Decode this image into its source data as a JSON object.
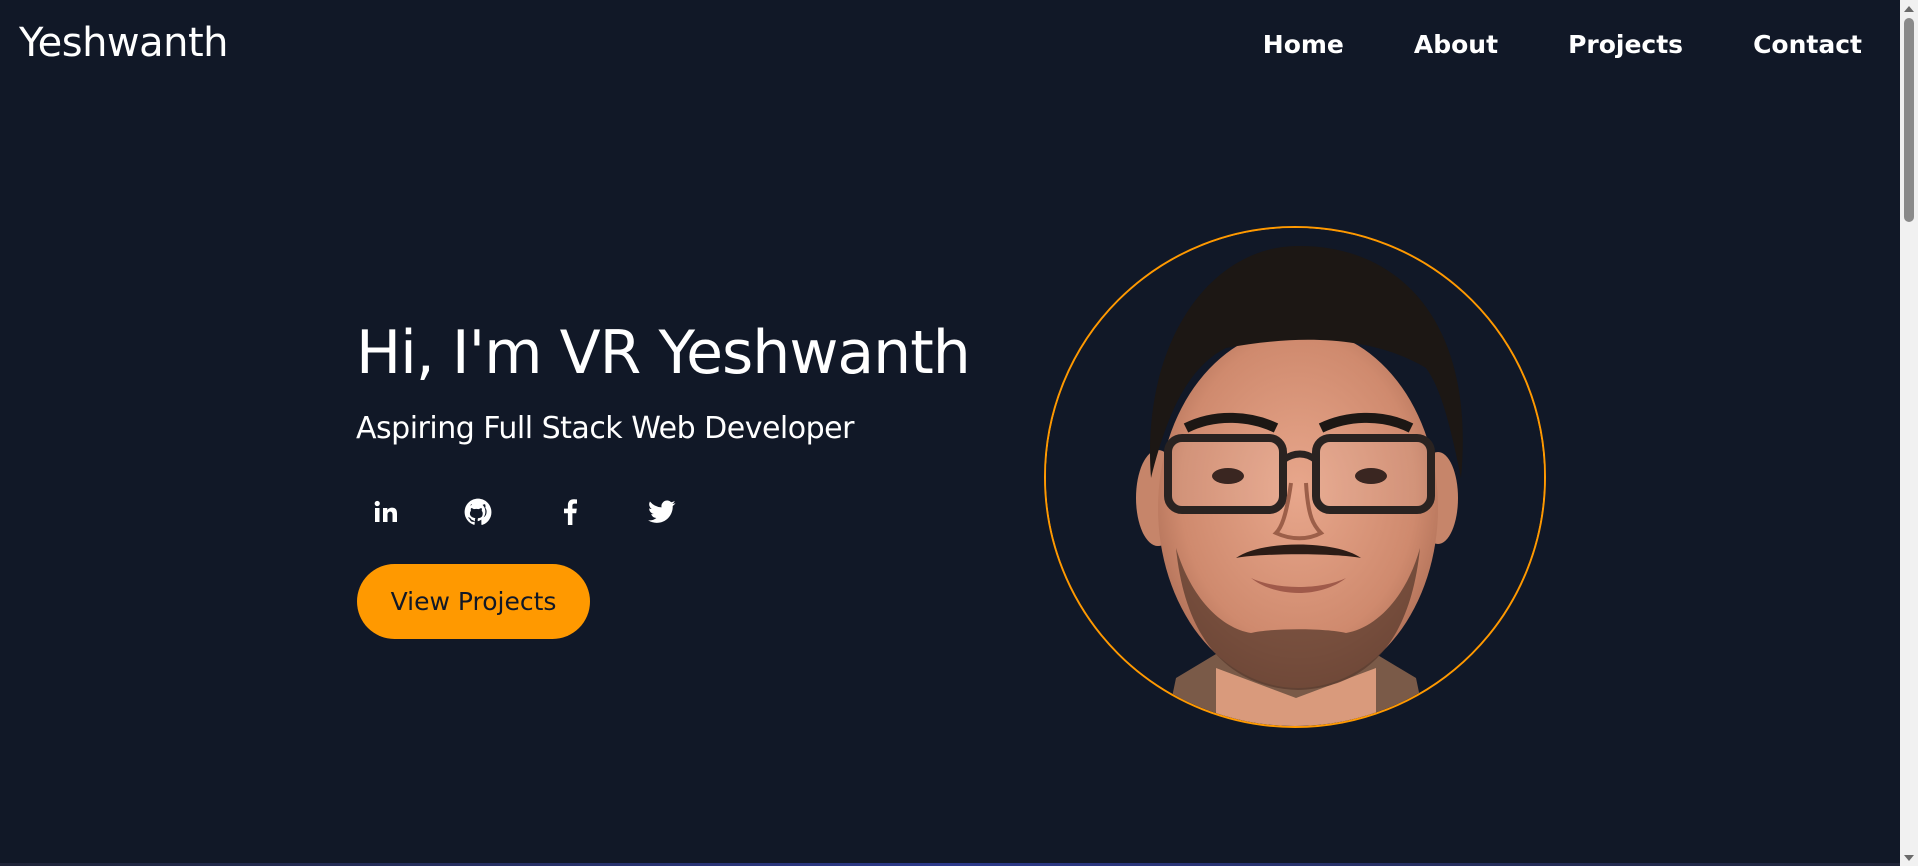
{
  "brand": "Yeshwanth",
  "nav": {
    "home": "Home",
    "about": "About",
    "projects": "Projects",
    "contact": "Contact"
  },
  "hero": {
    "title": "Hi, I'm VR Yeshwanth",
    "subtitle": "Aspiring Full Stack Web Developer",
    "cta_label": "View Projects"
  },
  "socials": [
    {
      "icon": "linkedin-icon"
    },
    {
      "icon": "github-icon"
    },
    {
      "icon": "facebook-icon"
    },
    {
      "icon": "twitter-icon"
    }
  ],
  "colors": {
    "background": "#111827",
    "accent": "#ff9900",
    "text": "#ffffff"
  }
}
